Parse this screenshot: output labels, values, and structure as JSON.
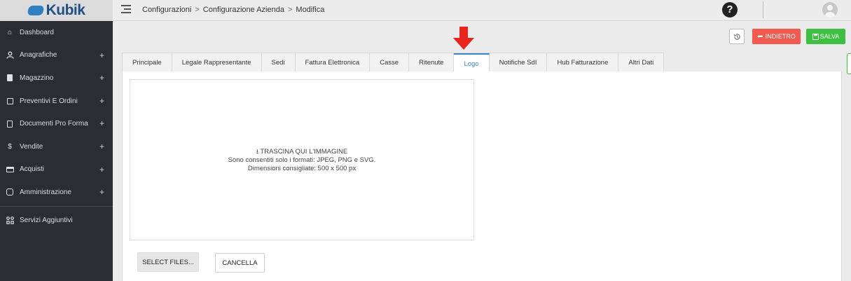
{
  "header": {
    "logo_text": "Kubik",
    "breadcrumb": [
      "Configurazioni",
      "Configurazione Azienda",
      "Modifica"
    ],
    "breadcrumb_sep": ">",
    "help_label": "?"
  },
  "sidebar": {
    "items": [
      {
        "label": "Dashboard",
        "icon": "home-icon",
        "expandable": false
      },
      {
        "label": "Anagrafiche",
        "icon": "user-icon",
        "expandable": true
      },
      {
        "label": "Magazzino",
        "icon": "box-icon",
        "expandable": true
      },
      {
        "label": "Preventivi E Ordini",
        "icon": "folder-icon",
        "expandable": true
      },
      {
        "label": "Documenti Pro Forma",
        "icon": "document-icon",
        "expandable": true
      },
      {
        "label": "Vendite",
        "icon": "dollar-icon",
        "expandable": true
      },
      {
        "label": "Acquisti",
        "icon": "card-icon",
        "expandable": true
      },
      {
        "label": "Amministrazione",
        "icon": "database-icon",
        "expandable": true
      },
      {
        "label": "Servizi Aggiuntivi",
        "icon": "apps-icon",
        "expandable": false
      }
    ],
    "plus": "+"
  },
  "toolbar": {
    "back_label": "INDIETRO",
    "save_label": "SALVA",
    "back_color": "#f05a4f",
    "save_color": "#3dbf41"
  },
  "tabs": [
    {
      "label": "Principale",
      "active": false
    },
    {
      "label": "Legale Rappresentante",
      "active": false
    },
    {
      "label": "Sedi",
      "active": false
    },
    {
      "label": "Fattura Elettronica",
      "active": false
    },
    {
      "label": "Casse",
      "active": false
    },
    {
      "label": "Ritenute",
      "active": false
    },
    {
      "label": "Logo",
      "active": true
    },
    {
      "label": "Notifiche SdI",
      "active": false
    },
    {
      "label": "Hub Fatturazione",
      "active": false
    },
    {
      "label": "Altri Dati",
      "active": false
    }
  ],
  "dropzone": {
    "title": "TRASCINA QUI L'IMMAGINE",
    "formats": "Sono consentiti solo i formati: JPEG, PNG e SVG.",
    "dimensions": "Dimensioni consigliate: 500 x 500 px"
  },
  "buttons": {
    "select_files": "SELECT FILES...",
    "cancel": "CANCELLA"
  }
}
